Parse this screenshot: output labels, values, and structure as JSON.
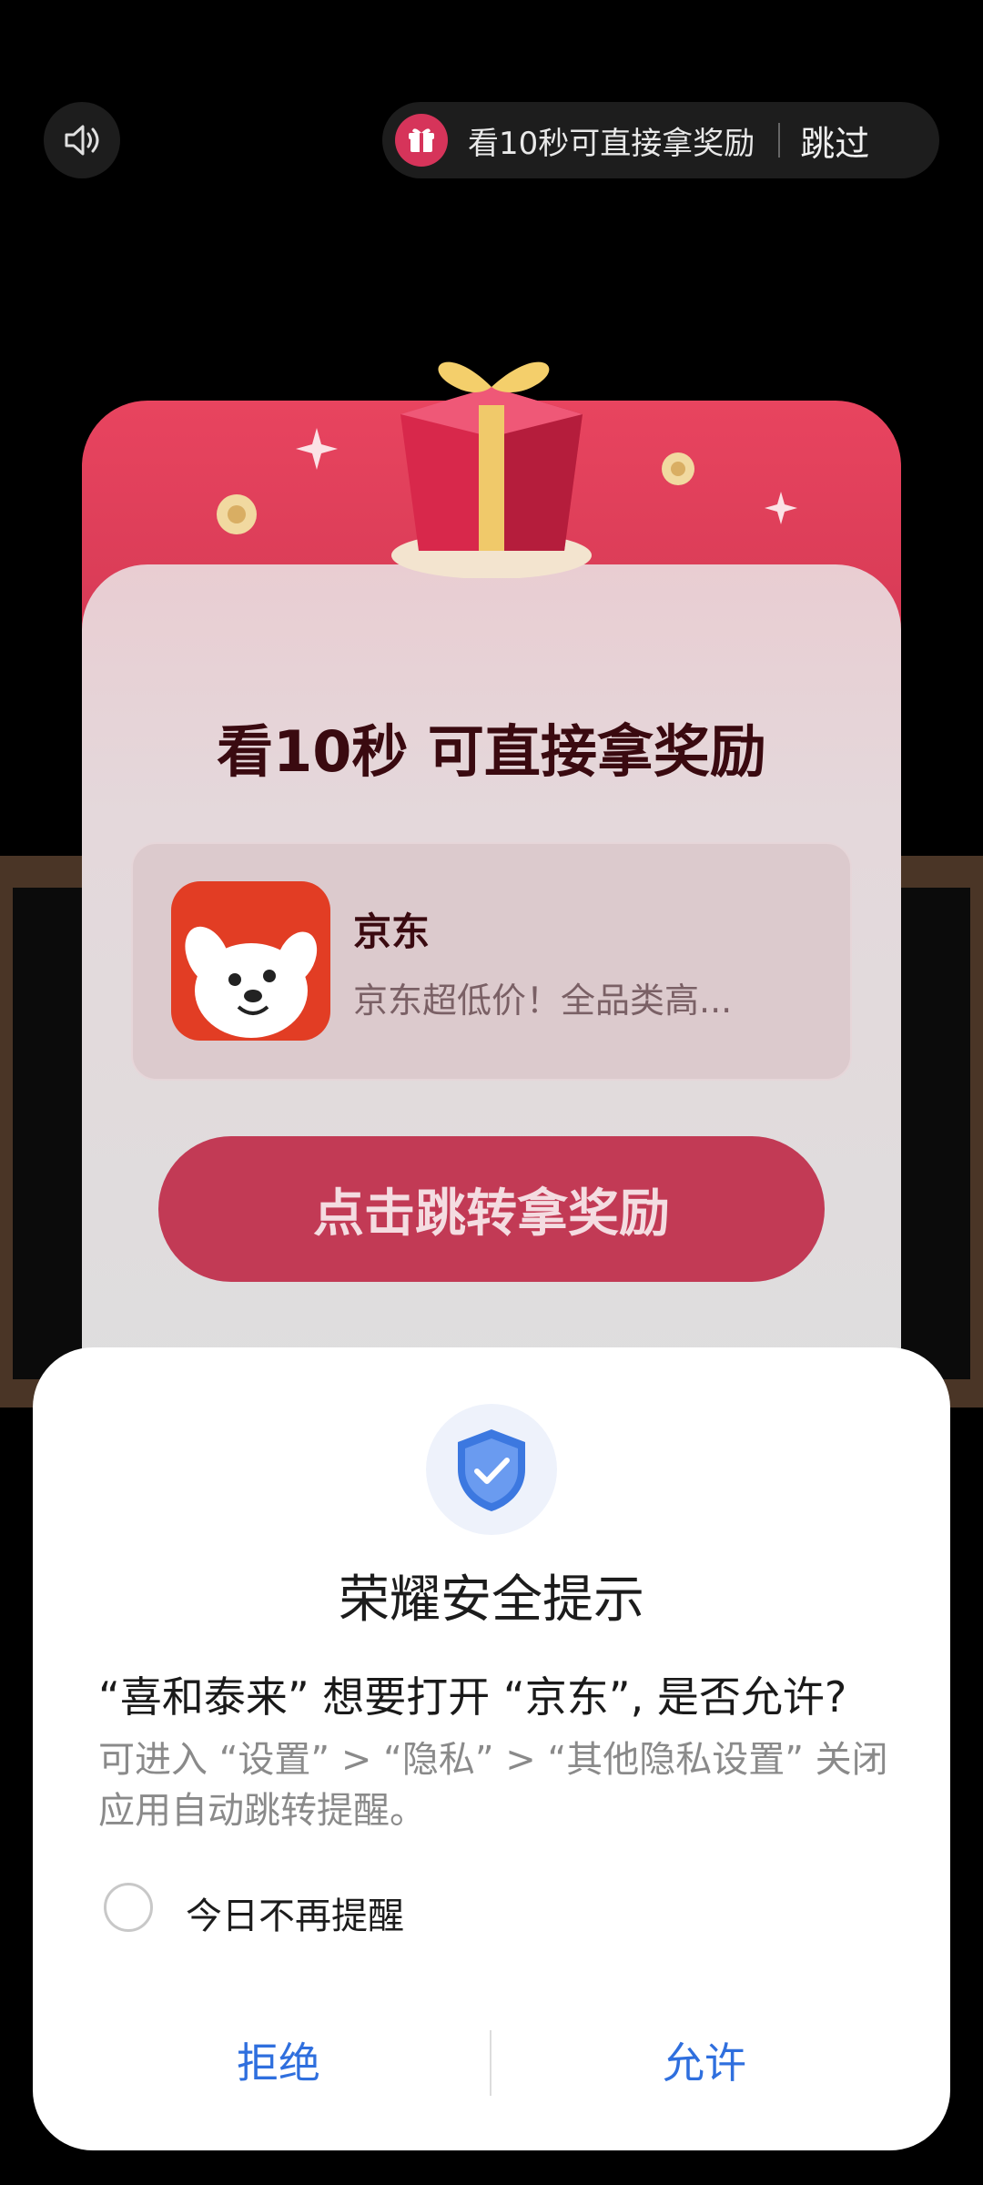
{
  "top_bar": {
    "reward_hint": "看10秒可直接拿奖励",
    "skip_label": "跳过"
  },
  "reward_card": {
    "title": "看10秒 可直接拿奖励",
    "app": {
      "name": "京东",
      "description": "京东超低价！全品类高..."
    },
    "jump_button": "点击跳转拿奖励"
  },
  "security_dialog": {
    "title": "荣耀安全提示",
    "question": "“喜和泰来” 想要打开 “京东”, 是否允许?",
    "hint": "可进入 “设置” > “隐私” > “其他隐私设置” 关闭应用自动跳转提醒。",
    "checkbox_label": "今日不再提醒",
    "deny_label": "拒绝",
    "allow_label": "允许"
  },
  "colors": {
    "accent_blue": "#2f6fde",
    "reward_red": "#c23a55",
    "jd_red": "#e23d24"
  }
}
